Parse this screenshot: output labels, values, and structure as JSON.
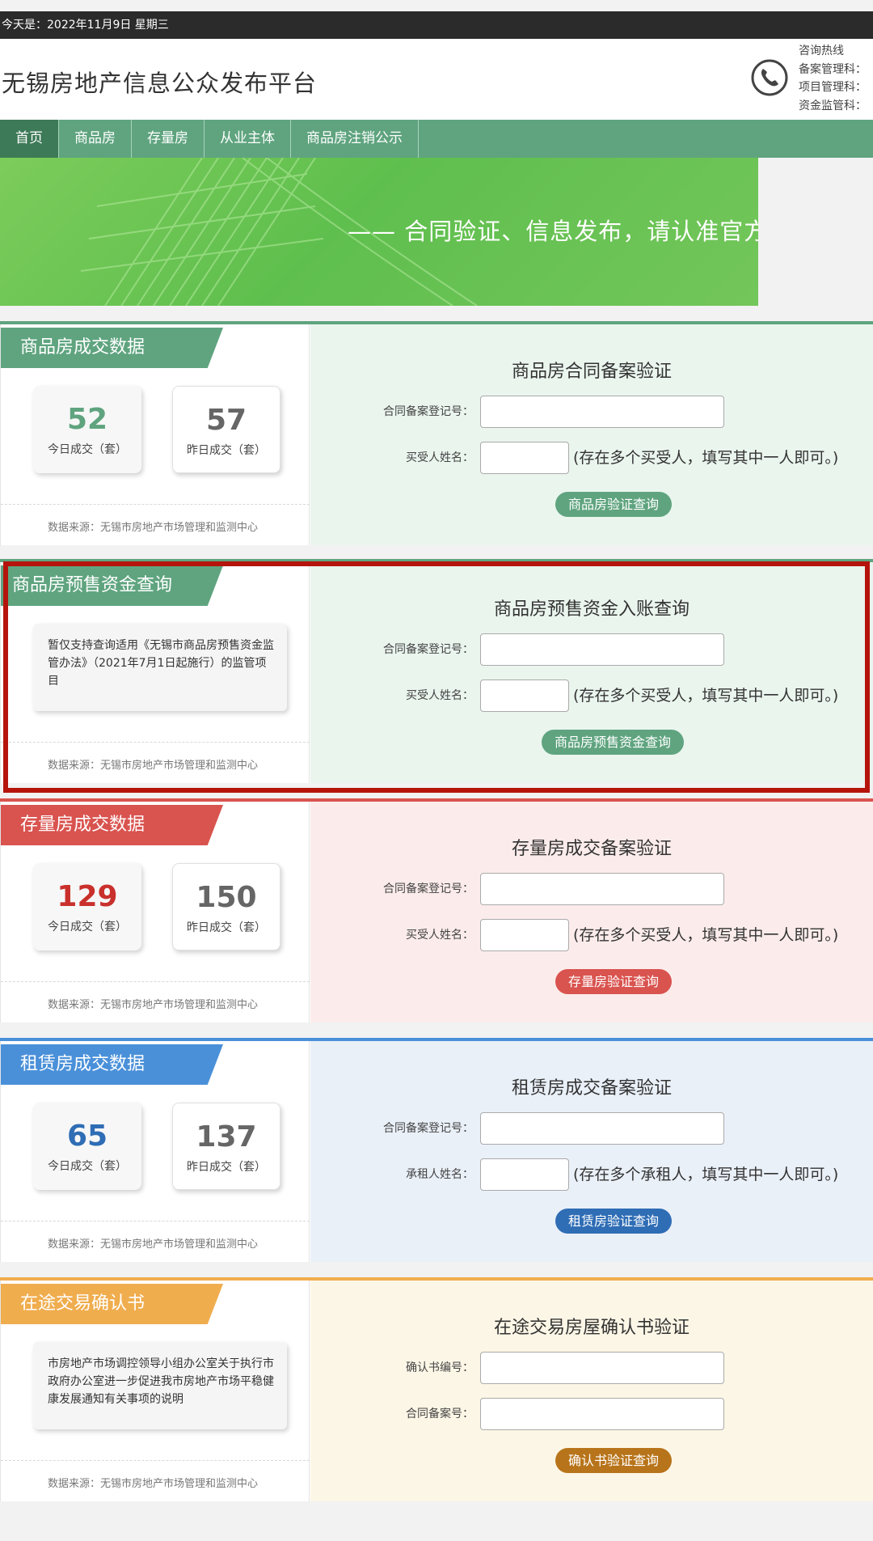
{
  "topbar": {
    "date_text": "今天是：2022年11月9日 星期三"
  },
  "header": {
    "site_title": "无锡房地产信息公众发布平台",
    "hotline_title": "咨询热线",
    "hotline_lines": [
      "备案管理科：",
      "项目管理科：",
      "资金监管科："
    ]
  },
  "nav": {
    "items": [
      {
        "label": "首页",
        "active": true
      },
      {
        "label": "商品房"
      },
      {
        "label": "存量房"
      },
      {
        "label": "从业主体"
      },
      {
        "label": "商品房注销公示"
      }
    ]
  },
  "banner": {
    "text": "—— 合同验证、信息发布，请认准官方"
  },
  "sections": [
    {
      "accent": "#5fa47f",
      "right_bg": "#eaf5ee",
      "tab_label": "商品房成交数据",
      "stats": {
        "today_value": "52",
        "today_label": "今日成交（套）",
        "yesterday_value": "57",
        "yesterday_label": "昨日成交（套）",
        "today_color": "#5fa47f"
      },
      "source": "数据来源：无锡市房地产市场管理和监测中心",
      "form": {
        "title": "商品房合同备案验证",
        "field1_label": "合同备案登记号：",
        "field2_label": "买受人姓名：",
        "hint": "(存在多个买受人，填写其中一人即可。)",
        "button": "商品房验证查询"
      }
    },
    {
      "accent": "#5fa47f",
      "right_bg": "#eaf5ee",
      "tab_label": "商品房预售资金查询",
      "info_text": "暂仅支持查询适用《无锡市商品房预售资金监管办法》（2021年7月1日起施行）的监管项目",
      "source": "数据来源：无锡市房地产市场管理和监测中心",
      "form": {
        "title": "商品房预售资金入账查询",
        "field1_label": "合同备案登记号：",
        "field2_label": "买受人姓名：",
        "hint": "(存在多个买受人，填写其中一人即可。)",
        "button": "商品房预售资金查询"
      }
    },
    {
      "accent": "#d9534f",
      "right_bg": "#fbeceb",
      "tab_label": "存量房成交数据",
      "stats": {
        "today_value": "129",
        "today_label": "今日成交（套）",
        "yesterday_value": "150",
        "yesterday_label": "昨日成交（套）",
        "today_color": "#c9302c"
      },
      "source": "数据来源：无锡市房地产市场管理和监测中心",
      "form": {
        "title": "存量房成交备案验证",
        "field1_label": "合同备案登记号：",
        "field2_label": "买受人姓名：",
        "hint": "(存在多个买受人，填写其中一人即可。)",
        "button": "存量房验证查询"
      }
    },
    {
      "accent": "#4a90d9",
      "right_bg": "#eaf0f8",
      "tab_label": "租赁房成交数据",
      "stats": {
        "today_value": "65",
        "today_label": "今日成交（套）",
        "yesterday_value": "137",
        "yesterday_label": "昨日成交（套）",
        "today_color": "#2f6db5"
      },
      "source": "数据来源：无锡市房地产市场管理和监测中心",
      "form": {
        "title": "租赁房成交备案验证",
        "field1_label": "合同备案登记号：",
        "field2_label": "承租人姓名：",
        "hint": "(存在多个承租人，填写其中一人即可。)",
        "button": "租赁房验证查询",
        "button_color": "#2f6db5"
      }
    },
    {
      "accent": "#f0ad4e",
      "right_bg": "#fcf6e6",
      "tab_label": "在途交易确认书",
      "info_text": "市房地产市场调控领导小组办公室关于执行市政府办公室进一步促进我市房地产市场平稳健康发展通知有关事项的说明",
      "source": "数据来源：无锡市房地产市场管理和监测中心",
      "form": {
        "title": "在途交易房屋确认书验证",
        "field1_label": "确认书编号：",
        "field2_label": "合同备案号：",
        "button": "确认书验证查询",
        "button_color": "#b8741a"
      }
    }
  ],
  "colors": {
    "nav_bg": "#5fa47f",
    "nav_active": "#3d7a57",
    "highlight_border": "#b5140c"
  }
}
